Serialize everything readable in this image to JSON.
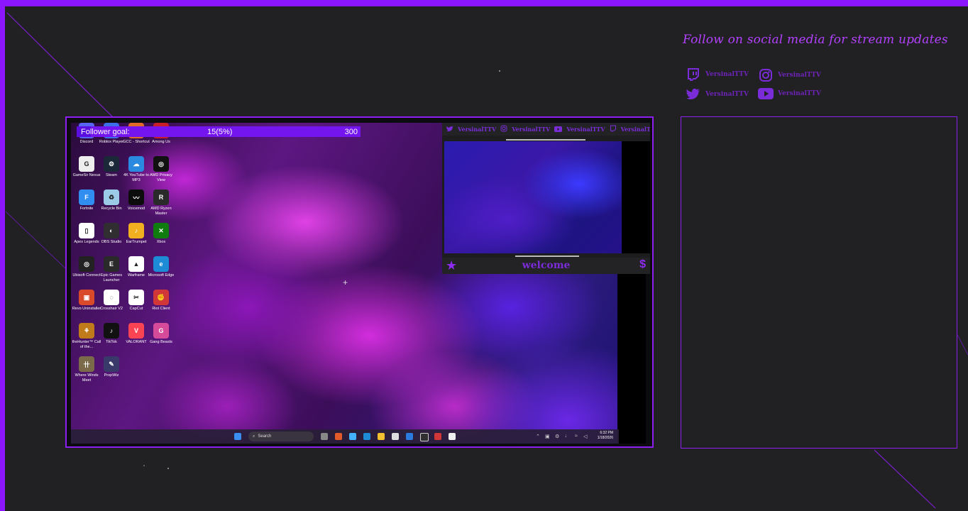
{
  "overlay": {
    "accent_color": "#8b16ff",
    "social_title": "Follow on social media for stream updates",
    "socials": [
      {
        "icon": "twitch-icon",
        "handle": "VersinalTTV"
      },
      {
        "icon": "instagram-icon",
        "handle": "VersinalTTV"
      },
      {
        "icon": "twitter-icon",
        "handle": "VersinalTTV"
      },
      {
        "icon": "youtube-icon",
        "handle": "VersinalTTV"
      }
    ]
  },
  "follower_goal": {
    "label": "Follower goal:",
    "progress_text": "15(5%)",
    "target": "300",
    "progress_fraction": 0.05
  },
  "desktop_icons": [
    {
      "label": "Discord",
      "color": "#5865f2",
      "glyph": "◉"
    },
    {
      "label": "Roblox Player",
      "color": "#3b6ee8",
      "glyph": "◆"
    },
    {
      "label": "GCC - Shortcut",
      "color": "#e06b2a",
      "glyph": "✿"
    },
    {
      "label": "Among Us",
      "color": "#c81e2a",
      "glyph": "●"
    },
    {
      "label": "GameSir Nexus",
      "color": "#eeeeee",
      "glyph": "G"
    },
    {
      "label": "Steam",
      "color": "#1b2838",
      "glyph": "⚙"
    },
    {
      "label": "4K YouTube to MP3",
      "color": "#2a8ae0",
      "glyph": "☁"
    },
    {
      "label": "AMD Privacy View",
      "color": "#111111",
      "glyph": "◎"
    },
    {
      "label": "Fortnite",
      "color": "#2f8ef0",
      "glyph": "F"
    },
    {
      "label": "Recycle Bin",
      "color": "#9ccbe8",
      "glyph": "♻"
    },
    {
      "label": "Voicemod",
      "color": "#0c0c0c",
      "glyph": "〰"
    },
    {
      "label": "AMD Ryzen Master",
      "color": "#2a2a2a",
      "glyph": "R"
    },
    {
      "label": "Apex Legends",
      "color": "#ffffff",
      "glyph": "▯"
    },
    {
      "label": "OBS Studio",
      "color": "#302e31",
      "glyph": "◐"
    },
    {
      "label": "EarTrumpet",
      "color": "#f0b020",
      "glyph": "♪"
    },
    {
      "label": "Xbox",
      "color": "#107c10",
      "glyph": "✕"
    },
    {
      "label": "Ubisoft Connect",
      "color": "#222222",
      "glyph": "◎"
    },
    {
      "label": "Epic Games Launcher",
      "color": "#2a2a2a",
      "glyph": "E"
    },
    {
      "label": "Warframe",
      "color": "#ffffff",
      "glyph": "▲"
    },
    {
      "label": "Microsoft Edge",
      "color": "#1e8bd6",
      "glyph": "e"
    },
    {
      "label": "Revo Uninstaller",
      "color": "#d84a2a",
      "glyph": "▣"
    },
    {
      "label": "Crosshair V2",
      "color": "#ffffff",
      "glyph": "◌"
    },
    {
      "label": "CapCut",
      "color": "#ffffff",
      "glyph": "✂"
    },
    {
      "label": "Riot Client",
      "color": "#d13639",
      "glyph": "✊"
    },
    {
      "label": "theHunter™ Call of the...",
      "color": "#c07a1a",
      "glyph": "⚘"
    },
    {
      "label": "TikTok",
      "color": "#111111",
      "glyph": "♪"
    },
    {
      "label": "VALORANT",
      "color": "#fa4454",
      "glyph": "V"
    },
    {
      "label": "Gang Beasts",
      "color": "#d64a9a",
      "glyph": "G"
    },
    {
      "label": "Where Winds Meet",
      "color": "#7a6a4a",
      "glyph": "卄"
    },
    {
      "label": "PropWiz",
      "color": "#3a3a6a",
      "glyph": "✎"
    }
  ],
  "taskbar": {
    "search_placeholder": "Search",
    "time": "6:32 PM",
    "date": "1/18/2026"
  },
  "cam": {
    "top_handles": [
      "VersinalTTV",
      "VersinalTTV",
      "VersinalTTV",
      "VersinalTTV"
    ],
    "welcome": "welcome",
    "dollar": "$"
  }
}
